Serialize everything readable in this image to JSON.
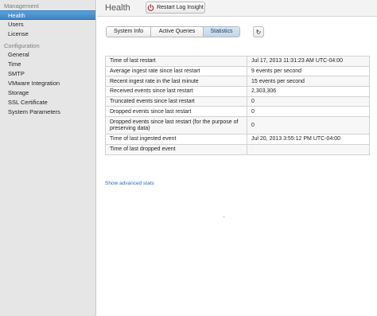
{
  "sidebar": {
    "sections": [
      {
        "title": "Management",
        "items": [
          {
            "label": "Health",
            "active": true
          },
          {
            "label": "Users",
            "active": false
          },
          {
            "label": "License",
            "active": false
          }
        ]
      },
      {
        "title": "Configuration",
        "items": [
          {
            "label": "General",
            "active": false
          },
          {
            "label": "Time",
            "active": false
          },
          {
            "label": "SMTP",
            "active": false
          },
          {
            "label": "VMware Integration",
            "active": false
          },
          {
            "label": "Storage",
            "active": false
          },
          {
            "label": "SSL Certificate",
            "active": false
          },
          {
            "label": "System Parameters",
            "active": false
          }
        ]
      }
    ]
  },
  "header": {
    "title": "Health",
    "restart_label": "Restart Log Insight",
    "restart_icon": "power-icon"
  },
  "tabs": [
    {
      "label": "System Info",
      "active": false
    },
    {
      "label": "Active Queries",
      "active": false
    },
    {
      "label": "Statistics",
      "active": true
    }
  ],
  "refresh": {
    "icon": "refresh-icon",
    "glyph": "↻"
  },
  "stats": [
    {
      "label": "Time of last restart",
      "value": "Jul 17, 2013 11:31:23 AM UTC-04:00"
    },
    {
      "label": "Average ingest rate since last restart",
      "value": "9 events per second"
    },
    {
      "label": "Recent ingest rate in the last minute",
      "value": "15 events per second"
    },
    {
      "label": "Received events since last restart",
      "value": "2,303,306"
    },
    {
      "label": "Truncated events since last restart",
      "value": "0"
    },
    {
      "label": "Dropped events since last restart",
      "value": "0"
    },
    {
      "label": "Dropped events since last restart (for the purpose of preserving data)",
      "value": "0"
    },
    {
      "label": "Time of last ingested event",
      "value": "Jul 20, 2013 3:55:12 PM UTC-04:00"
    },
    {
      "label": "Time of last dropped event",
      "value": ""
    }
  ],
  "advanced_link": "Show advanced stats",
  "colors": {
    "sidebar_bg": "#e6e6e6",
    "active_item": "#4a93d0",
    "link": "#2a6fbf",
    "restart_icon": "#c0262b"
  }
}
